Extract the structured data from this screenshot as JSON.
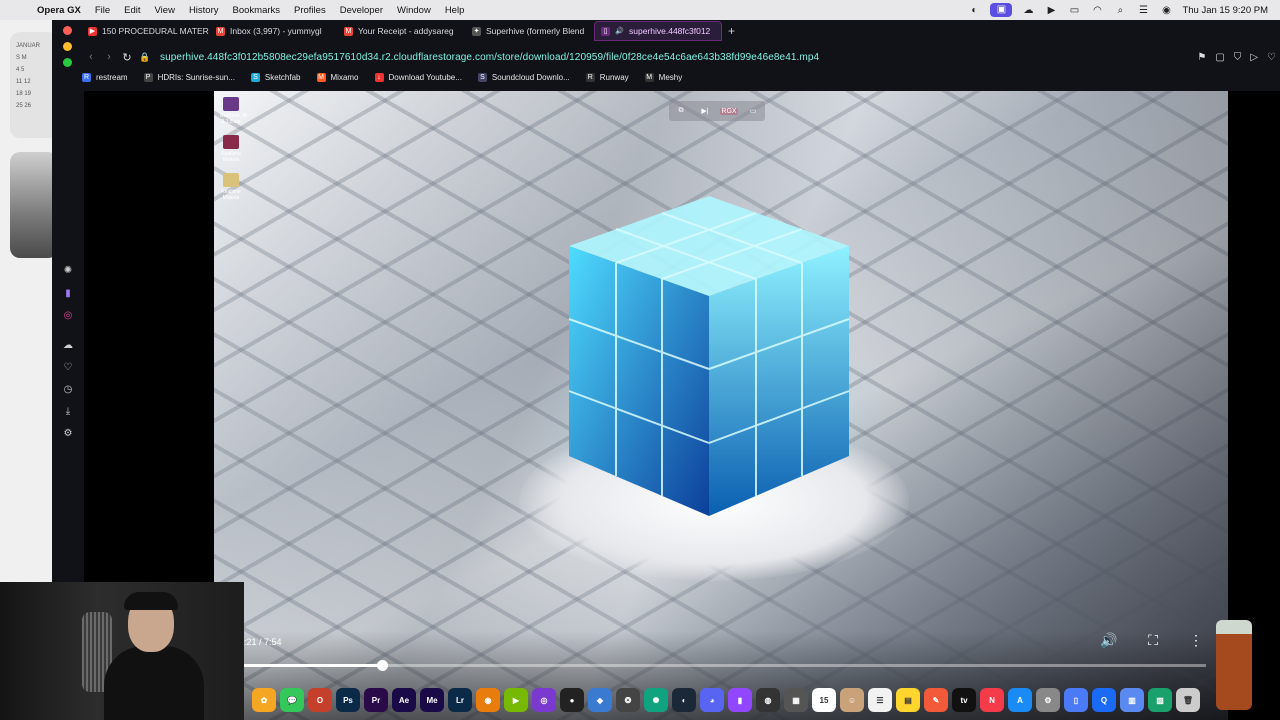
{
  "menubar": {
    "app": "Opera GX",
    "menus": [
      "File",
      "Edit",
      "View",
      "History",
      "Bookmarks",
      "Profiles",
      "Developer",
      "Window",
      "Help"
    ],
    "datetime": "Thu Jan 15  9:20 PM"
  },
  "calendar_widget": {
    "month": "JANUAR",
    "rows": [
      "S M",
      "4 5",
      "11 12",
      "18 19",
      "25 26"
    ]
  },
  "tabs": [
    {
      "label": "150 PROCEDURAL MATER",
      "color": "#e33"
    },
    {
      "label": "Inbox (3,997) - yummygl",
      "color": "#ea4335"
    },
    {
      "label": "Your Receipt - addysareg",
      "color": "#ea4335"
    },
    {
      "label": "Superhive (formerly Blend",
      "color": "#888"
    },
    {
      "label": "superhive.448fc3f012",
      "color": "#c66"
    }
  ],
  "address": {
    "url": "superhive.448fc3f012b5808ec29efa9517610d34.r2.cloudflarestorage.com/store/download/120959/file/0f28ce4e54c6ae643b38fd99e46e8e41.mp4"
  },
  "bookmarks": [
    {
      "label": "restream",
      "color": "#3a6ff0",
      "glyph": "R"
    },
    {
      "label": "HDRIs: Sunrise-sun...",
      "color": "#444",
      "glyph": "P"
    },
    {
      "label": "Sketchfab",
      "color": "#1caad9",
      "glyph": "S"
    },
    {
      "label": "Mixamo",
      "color": "#ff5a1f",
      "glyph": "M"
    },
    {
      "label": "Download Youtube...",
      "color": "#e33",
      "glyph": "↓"
    },
    {
      "label": "Soundcloud Downlo...",
      "color": "#446",
      "glyph": "S"
    },
    {
      "label": "Runway",
      "color": "#333",
      "glyph": "R"
    },
    {
      "label": "Meshy",
      "color": "#333",
      "glyph": "M"
    }
  ],
  "video_top_controls": [
    "⧉",
    "▶|",
    "RGX",
    "▭"
  ],
  "desktop_icons": [
    {
      "label": "Realtime_M 2.1.5.zip",
      "color": "#6a3a8a"
    },
    {
      "label": "Realtime Materia",
      "color": "#8a2a4a"
    },
    {
      "label": "Realtime Materia",
      "color": "#d9c37a"
    }
  ],
  "player": {
    "time": ":21 / 7:54",
    "progress": 0.143,
    "volume_icon": "volume-icon",
    "fullscreen_icon": "fullscreen-icon",
    "more_icon": "more-options-icon"
  },
  "dock": [
    {
      "name": "photos",
      "color": "#f5a623",
      "glyph": "✿"
    },
    {
      "name": "messages",
      "color": "#34c759",
      "glyph": "💬"
    },
    {
      "name": "opera",
      "color": "#c4402a",
      "glyph": "O"
    },
    {
      "name": "photoshop",
      "color": "#0a2a48",
      "glyph": "Ps"
    },
    {
      "name": "premiere",
      "color": "#2a0a48",
      "glyph": "Pr"
    },
    {
      "name": "after-effects",
      "color": "#1a0a48",
      "glyph": "Ae"
    },
    {
      "name": "media-encoder",
      "color": "#1a0a48",
      "glyph": "Me"
    },
    {
      "name": "lightroom",
      "color": "#0a2a48",
      "glyph": "Lr"
    },
    {
      "name": "blender",
      "color": "#e87d0d",
      "glyph": "◉"
    },
    {
      "name": "nvidia",
      "color": "#76b900",
      "glyph": "▶"
    },
    {
      "name": "app-purple",
      "color": "#7a3ad0",
      "glyph": "◎"
    },
    {
      "name": "obs",
      "color": "#222",
      "glyph": "●"
    },
    {
      "name": "app-blue",
      "color": "#3a7ad0",
      "glyph": "◆"
    },
    {
      "name": "davinci",
      "color": "#444",
      "glyph": "❂"
    },
    {
      "name": "chatgpt",
      "color": "#10a37f",
      "glyph": "✺"
    },
    {
      "name": "steam",
      "color": "#1b2838",
      "glyph": "◐"
    },
    {
      "name": "discord",
      "color": "#5865f2",
      "glyph": "◕"
    },
    {
      "name": "twitch",
      "color": "#9146ff",
      "glyph": "▮"
    },
    {
      "name": "app-dark",
      "color": "#333",
      "glyph": "◍"
    },
    {
      "name": "calculator",
      "color": "#555",
      "glyph": "▦"
    },
    {
      "name": "calendar",
      "color": "#fff",
      "glyph": "15"
    },
    {
      "name": "contacts",
      "color": "#c9a27a",
      "glyph": "☺"
    },
    {
      "name": "reminders",
      "color": "#f2f2f2",
      "glyph": "☰"
    },
    {
      "name": "notes",
      "color": "#ffd52e",
      "glyph": "▤"
    },
    {
      "name": "freeform",
      "color": "#f25a3a",
      "glyph": "✎"
    },
    {
      "name": "apple-tv",
      "color": "#111",
      "glyph": "tv"
    },
    {
      "name": "news",
      "color": "#f53a4a",
      "glyph": "N"
    },
    {
      "name": "app-store",
      "color": "#1a8af5",
      "glyph": "A"
    },
    {
      "name": "settings",
      "color": "#888",
      "glyph": "⚙"
    },
    {
      "name": "preview",
      "color": "#4a7af5",
      "glyph": "▯"
    },
    {
      "name": "quicktime",
      "color": "#1a6af5",
      "glyph": "Q"
    },
    {
      "name": "finder-2",
      "color": "#5a8af0",
      "glyph": "▥"
    },
    {
      "name": "activity",
      "color": "#1aa06a",
      "glyph": "▧"
    },
    {
      "name": "trash",
      "color": "#ccc",
      "glyph": "🗑"
    }
  ]
}
